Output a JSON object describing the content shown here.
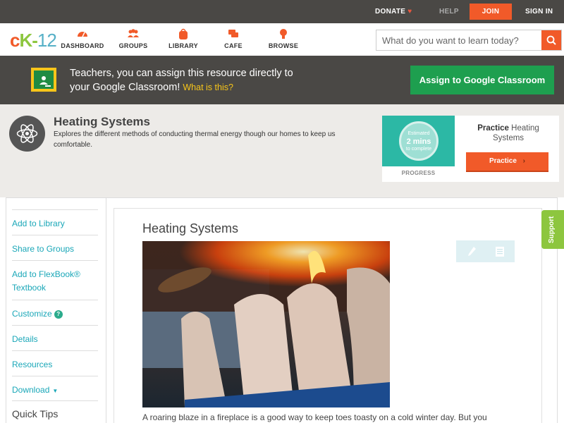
{
  "topbar": {
    "donate": "DONATE",
    "help": "HELP",
    "join": "JOIN",
    "signin": "SIGN IN"
  },
  "nav": {
    "logo": {
      "c": "c",
      "k": "K",
      "dash": "-",
      "num": "12"
    },
    "items": [
      {
        "label": "DASHBOARD",
        "icon": "dashboard-gauge-icon"
      },
      {
        "label": "GROUPS",
        "icon": "groups-people-icon"
      },
      {
        "label": "LIBRARY",
        "icon": "library-bag-icon"
      },
      {
        "label": "CAFE",
        "icon": "cafe-chat-icon"
      },
      {
        "label": "BROWSE",
        "icon": "browse-bulb-icon"
      }
    ],
    "search_placeholder": "What do you want to learn today?"
  },
  "banner": {
    "line1": "Teachers, you can assign this resource directly to",
    "line2": "your Google Classroom!",
    "what": "What is this?",
    "assign_button": "Assign to Google Classroom"
  },
  "hero": {
    "title": "Heating Systems",
    "description": "Explores the different methods of conducting thermal energy though our homes to keep us comfortable."
  },
  "practice": {
    "estimated": "Estimated",
    "mins": "2 mins",
    "to_complete": "to complete",
    "progress_label": "PROGRESS",
    "title_bold": "Practice",
    "title_rest": "Heating Systems",
    "button": "Practice"
  },
  "sidebar": {
    "items": [
      {
        "label": "Add to Library"
      },
      {
        "label": "Share to Groups"
      },
      {
        "label": "Add to FlexBook® Textbook"
      },
      {
        "label": "Customize"
      },
      {
        "label": "Details"
      },
      {
        "label": "Resources"
      },
      {
        "label": "Download"
      }
    ],
    "quick_tips": "Quick Tips"
  },
  "content": {
    "title": "Heating Systems",
    "paragraph": "A roaring blaze in a fireplace is a good way to keep toes toasty on a cold winter day. But you"
  },
  "support": "Support",
  "colors": {
    "accent": "#f15a29",
    "green": "#1e9f4f",
    "teal_link": "#1aa7b8",
    "dark_bar": "#4a4845"
  }
}
